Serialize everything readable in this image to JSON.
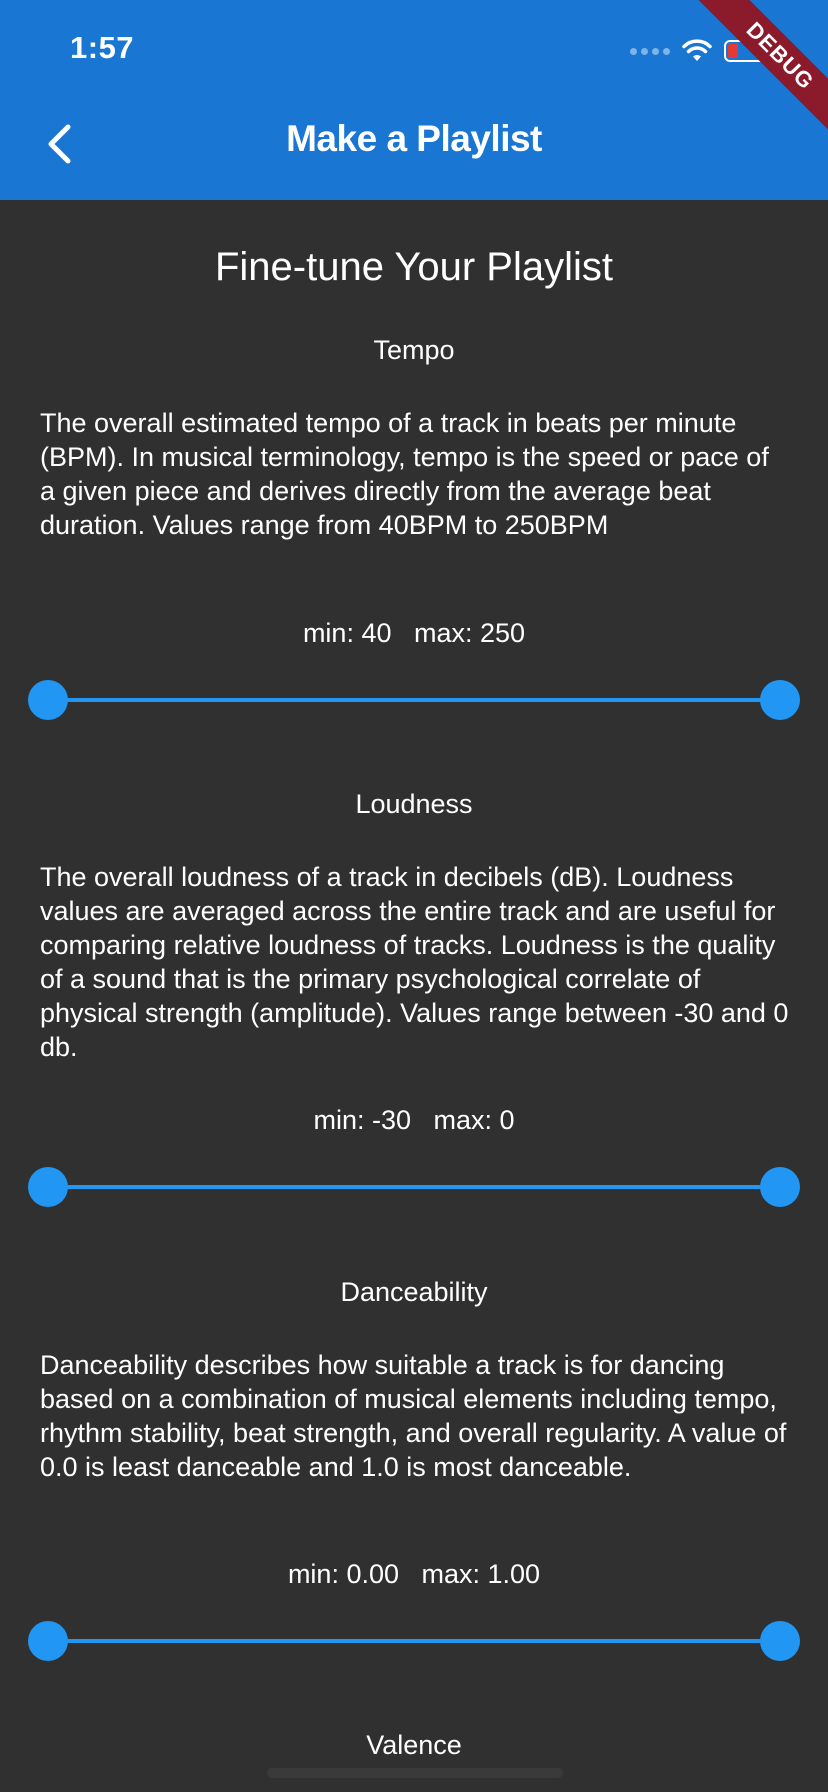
{
  "status_bar": {
    "time": "1:57"
  },
  "debug_banner": "DEBUG",
  "app_bar": {
    "title": "Make a Playlist"
  },
  "page": {
    "title": "Fine-tune Your Playlist"
  },
  "sections": [
    {
      "title": "Tempo",
      "description": "The overall estimated tempo of a track in beats per minute (BPM). In musical terminology, tempo is the speed or pace of a given piece and derives directly from the average beat duration. Values range from 40BPM to 250BPM",
      "range_label": "min: 40   max: 250",
      "min": 40,
      "max": 250
    },
    {
      "title": "Loudness",
      "description": "The overall loudness of a track in decibels (dB). Loudness values are averaged across the entire track and are useful for comparing relative loudness of tracks. Loudness is the quality of a sound that is the primary psychological correlate of physical strength (amplitude). Values range between -30 and 0 db.",
      "range_label": "min: -30   max: 0",
      "min": -30,
      "max": 0
    },
    {
      "title": "Danceability",
      "description": "Danceability describes how suitable a track is for dancing based on a combination of musical elements including tempo, rhythm stability, beat strength, and overall regularity. A value of 0.0 is least danceable and 1.0 is most danceable.",
      "range_label": "min: 0.00   max: 1.00",
      "min": 0.0,
      "max": 1.0
    },
    {
      "title": "Valence"
    }
  ],
  "colors": {
    "app_bar": "#1976D2",
    "background": "#303030",
    "accent": "#2196F3"
  }
}
